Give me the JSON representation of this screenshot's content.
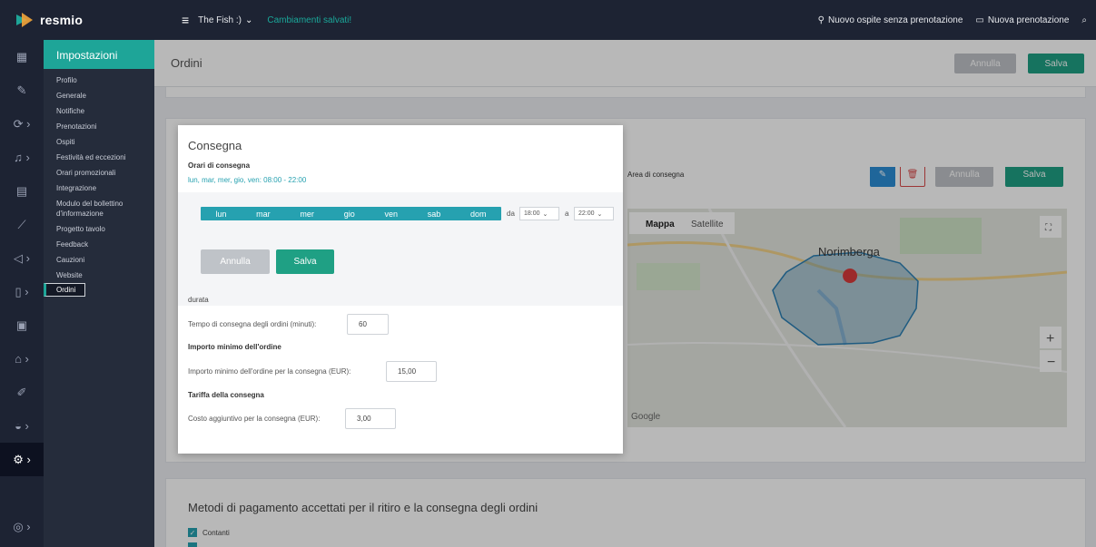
{
  "topbar": {
    "brand": "resmio",
    "venue": "The Fish :)",
    "changes": "Cambiamenti salvati!",
    "walk_in": "Nuovo ospite senza prenotazione",
    "new_reservation": "Nuova prenotazione"
  },
  "submenu": {
    "header": "Impostazioni",
    "items": [
      "Profilo",
      "Generale",
      "Notifiche",
      "Prenotazioni",
      "Ospiti",
      "Festività ed eccezioni",
      "Orari promozionali",
      "Integrazione",
      "Modulo del bollettino d'informazione",
      "Progetto tavolo",
      "Feedback",
      "Cauzioni",
      "Website",
      "Ordini"
    ],
    "selected": "Ordini"
  },
  "header": {
    "title": "Ordini",
    "cancel": "Annulla",
    "save": "Salva"
  },
  "modal": {
    "title": "Consegna",
    "hours_label": "Orari di consegna",
    "hours_value": "lun, mar, mer, gio, ven: 08:00 - 22:00",
    "days": [
      "lun",
      "mar",
      "mer",
      "gio",
      "ven",
      "sab",
      "dom"
    ],
    "from_label": "da",
    "from_value": "18:00",
    "to_label": "a",
    "to_value": "22:00",
    "cancel": "Annulla",
    "save": "Salva",
    "duration_label": "durata",
    "duration_field_label": "Tempo di consegna degli ordini (minuti):",
    "duration_value": "60",
    "min_label": "Importo minimo dell'ordine",
    "min_field_label": "Importo minimo dell'ordine per la consegna (EUR):",
    "min_value": "15,00",
    "fee_label": "Tariffa della consegna",
    "fee_field_label": "Costo aggiuntivo per la consegna (EUR):",
    "fee_value": "3,00"
  },
  "map_area": {
    "label": "Area di consegna",
    "cancel": "Annulla",
    "save": "Salva",
    "tab_map": "Mappa",
    "tab_satellite": "Satellite",
    "city": "Norimberga",
    "google": "Google"
  },
  "payments": {
    "title": "Metodi di pagamento accettati per il ritiro e la consegna degli ordini",
    "cash": "Contanti"
  }
}
